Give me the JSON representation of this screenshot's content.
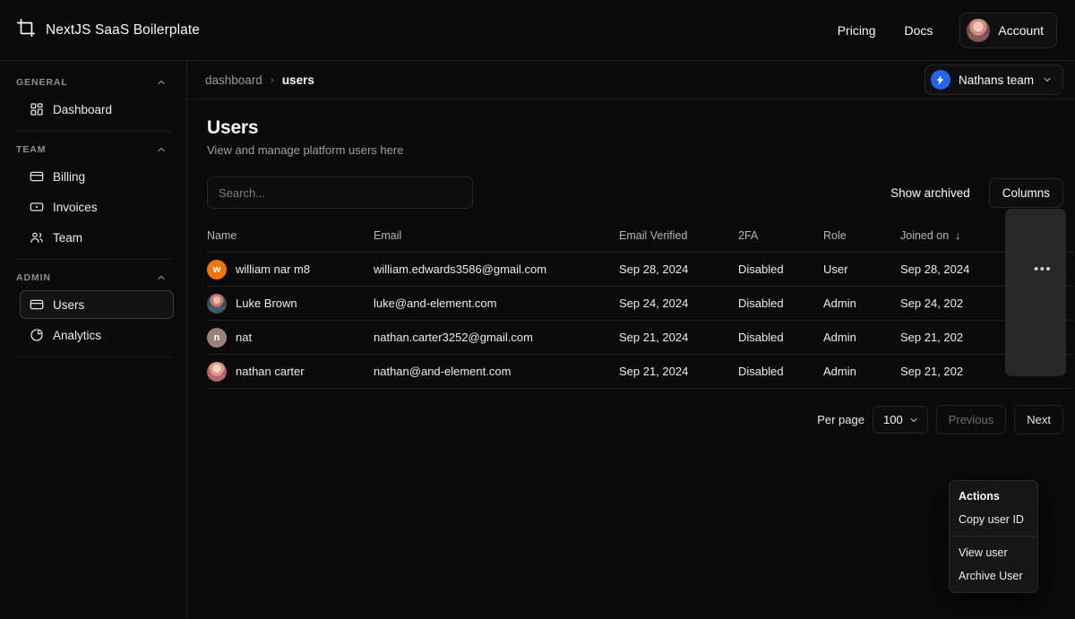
{
  "brand": {
    "name": "NextJS SaaS Boilerplate",
    "logo_icon": "frame-crop-icon"
  },
  "topnav": {
    "pricing": "Pricing",
    "docs": "Docs",
    "account": "Account"
  },
  "sidebar": {
    "groups": [
      {
        "label": "GENERAL",
        "items": [
          {
            "label": "Dashboard",
            "icon": "grid-dashboard-icon",
            "active": false
          }
        ]
      },
      {
        "label": "TEAM",
        "items": [
          {
            "label": "Billing",
            "icon": "credit-card-icon",
            "active": false
          },
          {
            "label": "Invoices",
            "icon": "invoice-icon",
            "active": false
          },
          {
            "label": "Team",
            "icon": "users-group-icon",
            "active": false
          }
        ]
      },
      {
        "label": "ADMIN",
        "items": [
          {
            "label": "Users",
            "icon": "credit-card-icon",
            "active": true
          },
          {
            "label": "Analytics",
            "icon": "pie-chart-icon",
            "active": false
          }
        ]
      }
    ]
  },
  "breadcrumb": {
    "parent": "dashboard",
    "separator": "›",
    "current": "users"
  },
  "team_switcher": {
    "name": "Nathans team",
    "chevron": "chevron-down-icon",
    "accent": "#2563eb"
  },
  "page": {
    "title": "Users",
    "subtitle": "View and manage platform users here"
  },
  "toolbar": {
    "search_placeholder": "Search...",
    "search_value": "",
    "show_archived": "Show archived",
    "columns": "Columns"
  },
  "table": {
    "columns": [
      "Name",
      "Email",
      "Email Verified",
      "2FA",
      "Role",
      "Joined on"
    ],
    "sorted_column": "Joined on",
    "sort_arrow": "↓",
    "rows": [
      {
        "name": "william nar m8",
        "avatar": {
          "type": "initial",
          "initial": "w",
          "color": "#f0750c"
        },
        "email": "william.edwards3586@gmail.com",
        "email_verified": "Sep 28, 2024",
        "twofa": "Disabled",
        "role": "User",
        "joined_on": "Sep 28, 2024"
      },
      {
        "name": "Luke Brown",
        "avatar": {
          "type": "photo",
          "style": "photo-a"
        },
        "email": "luke@and-element.com",
        "email_verified": "Sep 24, 2024",
        "twofa": "Disabled",
        "role": "Admin",
        "joined_on": "Sep 24, 202"
      },
      {
        "name": "nat",
        "avatar": {
          "type": "initial",
          "initial": "n",
          "color": "#9c8178"
        },
        "email": "nathan.carter3252@gmail.com",
        "email_verified": "Sep 21, 2024",
        "twofa": "Disabled",
        "role": "Admin",
        "joined_on": "Sep 21, 202"
      },
      {
        "name": "nathan carter",
        "avatar": {
          "type": "photo",
          "style": "photo-c"
        },
        "email": "nathan@and-element.com",
        "email_verified": "Sep 21, 2024",
        "twofa": "Disabled",
        "role": "Admin",
        "joined_on": "Sep 21, 202"
      }
    ],
    "row_actions_glyph": "•••"
  },
  "actions_menu": {
    "label": "Actions",
    "items_top": [
      "Copy user ID"
    ],
    "items_bottom": [
      "View user",
      "Archive User"
    ]
  },
  "pagination": {
    "per_page_label": "Per page",
    "per_page_value": "100",
    "chevron": "chevron-down-icon",
    "previous": "Previous",
    "next": "Next"
  }
}
